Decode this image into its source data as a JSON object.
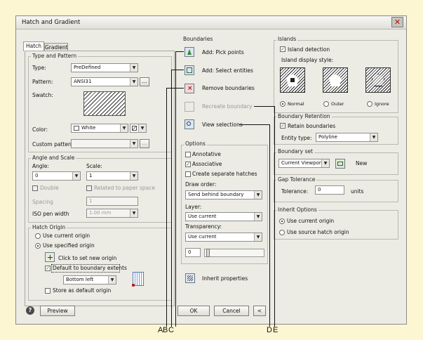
{
  "window": {
    "title": "Hatch and Gradient",
    "close_glyph": "✕"
  },
  "tabs": [
    {
      "label": "Hatch"
    },
    {
      "label": "Gradient"
    }
  ],
  "type_pattern": {
    "group": "Type and Pattern",
    "type_label": "Type:",
    "type_value": "PreDefined",
    "pattern_label": "Pattern:",
    "pattern_value": "ANSI31",
    "pattern_more": "...",
    "swatch_label": "Swatch:",
    "color_label": "Color:",
    "color_value": "White",
    "custom_label": "Custom pattern:",
    "custom_more": "..."
  },
  "angle_scale": {
    "group": "Angle and Scale",
    "angle_label": "Angle:",
    "angle_value": "0",
    "scale_label": "Scale:",
    "scale_value": "1",
    "double_label": "Double",
    "relative_label": "Related to paper space",
    "spacing_label": "Spacing",
    "spacing_value": "1",
    "iso_label": "ISO pen width",
    "iso_value": "1.00 mm"
  },
  "hatch_origin": {
    "group": "Hatch Origin",
    "use_current": "Use current origin",
    "use_specified": "Use specified origin",
    "click_set": "Click to set new origin",
    "default_extents": "Default to boundary extents",
    "position_value": "Bottom left",
    "store_default": "Store as default origin"
  },
  "boundaries": {
    "group": "Boundaries",
    "add_pick": "Add: Pick points",
    "add_select": "Add: Select entities",
    "remove": "Remove boundaries",
    "recreate": "Recreate boundary",
    "view": "View selections"
  },
  "options": {
    "group": "Options",
    "annotative": "Annotative",
    "associative": "Associative",
    "separate": "Create separate hatches",
    "draw_order_label": "Draw order:",
    "draw_order_value": "Send behind boundary",
    "layer_label": "Layer:",
    "layer_value": "Use current",
    "transparency_label": "Transparency:",
    "transparency_value": "Use current",
    "transparency_amount": "0",
    "inherit_props": "Inherit properties"
  },
  "islands": {
    "group": "Islands",
    "detection": "Island detection",
    "style_label": "Island display style:",
    "styles": [
      "Normal",
      "Outer",
      "Ignore"
    ]
  },
  "boundary_retention": {
    "group": "Boundary Retention",
    "retain": "Retain boundaries",
    "entity_label": "Entity type:",
    "entity_value": "Polyline"
  },
  "boundary_set": {
    "group": "Boundary set",
    "value": "Current Viewport",
    "new_label": "New"
  },
  "gap": {
    "group": "Gap Tolerance",
    "label": "Tolerance:",
    "value": "0",
    "units": "units"
  },
  "inherit": {
    "group": "Inherit Options",
    "use_current": "Use current origin",
    "use_source": "Use source hatch origin"
  },
  "footer": {
    "preview": "Preview",
    "ok": "OK",
    "cancel": "Cancel",
    "collapse": "<"
  },
  "callouts": [
    "A",
    "B",
    "C",
    "D",
    "E"
  ]
}
